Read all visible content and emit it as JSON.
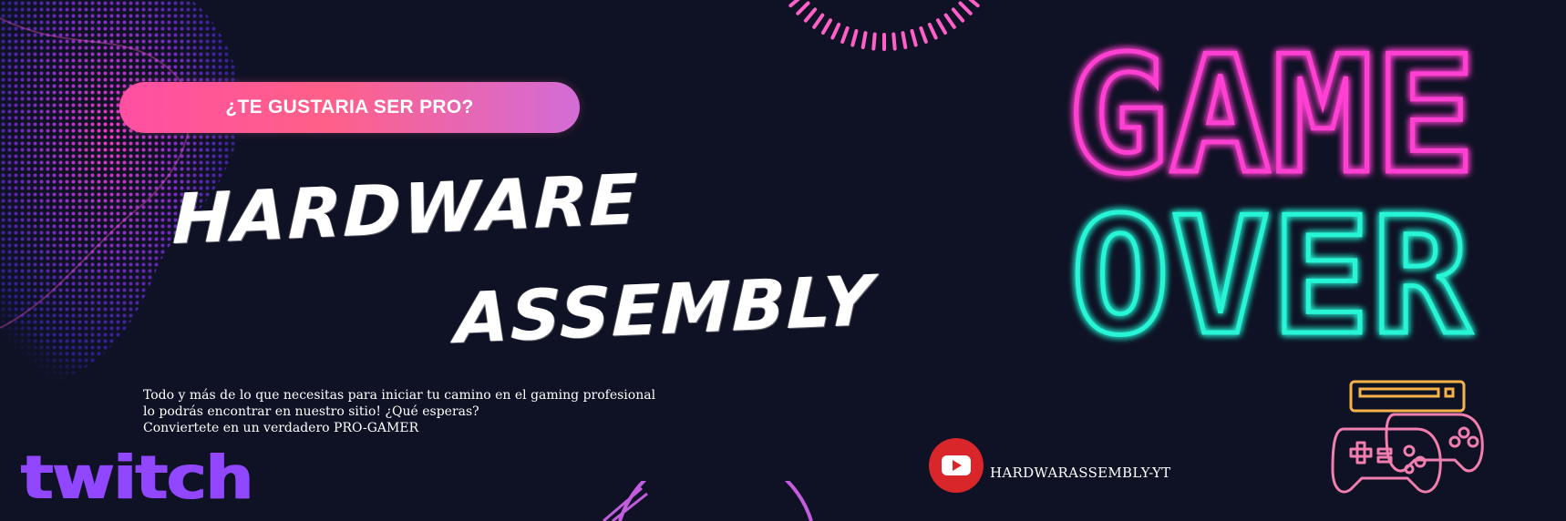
{
  "banner": {
    "pill_text": "¿TE GUSTARIA SER PRO?",
    "title_line1": "HARDWARE",
    "title_line2": "ASSEMBLY",
    "description_lines": [
      "Todo y más de lo que necesitas para iniciar tu camino en el gaming profesional",
      "lo podrás encontrar en nuestro sitio! ¿Qué esperas?",
      "Conviertete en un verdadero PRO-GAMER"
    ],
    "twitch_logo": "twitch",
    "youtube_handle": "HARDWARASSEMBLY-YT",
    "neon_line1": "GAME",
    "neon_line2": "OVER"
  },
  "colors": {
    "background": "#0f1224",
    "pill_gradient_start": "#ff4fa3",
    "pill_gradient_end": "#d36cd6",
    "neon_pink": "#ff3fd2",
    "neon_cyan": "#27f5d6",
    "twitch_purple": "#9146ff",
    "youtube_red": "#d8262a",
    "controller_outline": "#f07fb0",
    "console_outline": "#f5b24a"
  },
  "icons": {
    "youtube": "youtube-play-icon",
    "controllers": "gamepad-icon",
    "console": "retro-console-icon"
  }
}
